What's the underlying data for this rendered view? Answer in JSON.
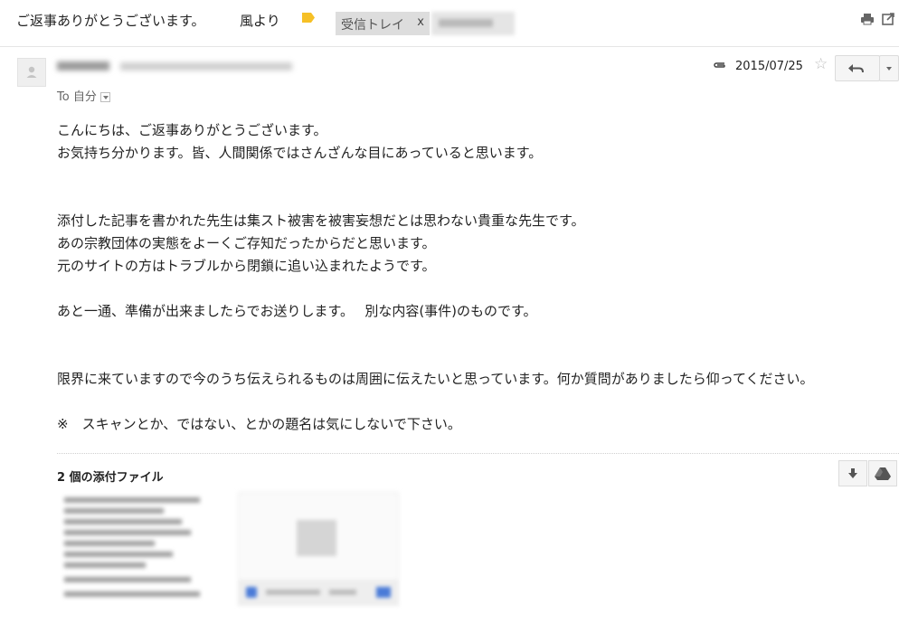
{
  "header": {
    "subject": "ご返事ありがとうございます。",
    "from_part": "風より",
    "labels": {
      "inbox": "受信トレイ",
      "inbox_remove": "x"
    }
  },
  "message": {
    "to_text": "To 自分",
    "date": "2015/07/25",
    "body_lines": [
      "こんにちは、ご返事ありがとうございます。",
      "お気持ち分かります。皆、人間関係ではさんざんな目にあっていると思います。",
      "",
      "",
      "添付した記事を書かれた先生は集スト被害を被害妄想だとは思わない貴重な先生です。",
      "あの宗教団体の実態をよーくご存知だったからだと思います。",
      "元のサイトの方はトラブルから閉鎖に追い込まれたようです。",
      "",
      "あと一通、準備が出来ましたらでお送りします。　 別な内容(事件)のものです。",
      "",
      "",
      "限界に来ていますので今のうち伝えられるものは周囲に伝えたいと思っています。何か質問がありましたら仰ってください。",
      "",
      "※　スキャンとか、ではない、とかの題名は気にしないで下さい。"
    ]
  },
  "attachments": {
    "title": "2 個の添付ファイル"
  },
  "icons": {
    "label_tag": "label-tag-icon",
    "print": "print-icon",
    "new_window": "new-window-icon",
    "avatar": "person-icon",
    "attachment": "paperclip-icon",
    "star": "star-icon",
    "reply": "reply-icon",
    "more": "chevron-down-icon",
    "download": "download-icon",
    "drive": "drive-icon"
  },
  "colors": {
    "label_tag": "#f6c026",
    "chip_bg": "#dddddd",
    "text": "#222222",
    "muted": "#666666"
  }
}
